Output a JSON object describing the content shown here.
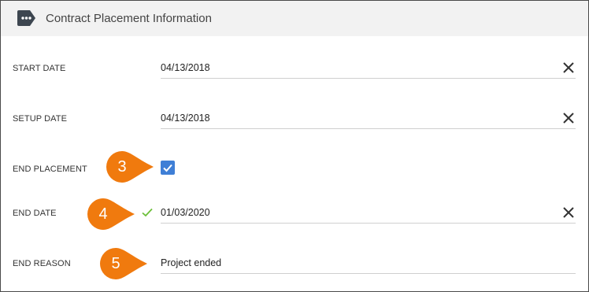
{
  "header": {
    "title": "Contract Placement Information",
    "icon": "tag-icon"
  },
  "fields": {
    "start_date": {
      "label": "START DATE",
      "value": "04/13/2018"
    },
    "setup_date": {
      "label": "SETUP DATE",
      "value": "04/13/2018"
    },
    "end_placement": {
      "label": "END PLACEMENT",
      "checked": true
    },
    "end_date": {
      "label": "END DATE",
      "value": "01/03/2020",
      "valid": true
    },
    "end_reason": {
      "label": "END REASON",
      "value": "Project ended"
    }
  },
  "callouts": [
    {
      "number": "3",
      "target": "end_placement"
    },
    {
      "number": "4",
      "target": "end_date"
    },
    {
      "number": "5",
      "target": "end_reason"
    }
  ],
  "colors": {
    "header_bg": "#f2f2f2",
    "checkbox": "#3f7fd6",
    "callout": "#f07a0e",
    "valid_check": "#6cbf3a"
  }
}
